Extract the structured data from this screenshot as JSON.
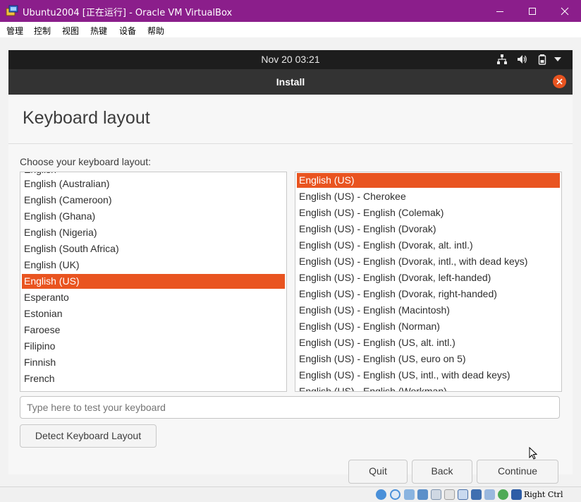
{
  "window": {
    "title": "Ubuntu2004 [正在运行] - Oracle VM VirtualBox",
    "icons": [
      "virtualbox-icon",
      "minimize-icon",
      "maximize-icon",
      "close-icon"
    ]
  },
  "menu": [
    "管理",
    "控制",
    "视图",
    "热键",
    "设备",
    "帮助"
  ],
  "topbar": {
    "clock": "Nov 20  03:21",
    "icons": [
      "network-icon",
      "volume-icon",
      "battery-icon",
      "chevron-down-icon"
    ]
  },
  "installer": {
    "header_title": "Install",
    "heading": "Keyboard layout",
    "prompt": "Choose your keyboard layout:",
    "layouts": [
      "English (Australian)",
      "English (Cameroon)",
      "English (Ghana)",
      "English (Nigeria)",
      "English (South Africa)",
      "English (UK)",
      "English (US)",
      "Esperanto",
      "Estonian",
      "Faroese",
      "Filipino",
      "Finnish",
      "French"
    ],
    "selected_layout": "English (US)",
    "variants": [
      "English (US)",
      "English (US) - Cherokee",
      "English (US) - English (Colemak)",
      "English (US) - English (Dvorak)",
      "English (US) - English (Dvorak, alt. intl.)",
      "English (US) - English (Dvorak, intl., with dead keys)",
      "English (US) - English (Dvorak, left-handed)",
      "English (US) - English (Dvorak, right-handed)",
      "English (US) - English (Macintosh)",
      "English (US) - English (Norman)",
      "English (US) - English (US, alt. intl.)",
      "English (US) - English (US, euro on 5)",
      "English (US) - English (US, intl., with dead keys)",
      "English (US) - English (Workman)"
    ],
    "selected_variant": "English (US)",
    "test_placeholder": "Type here to test your keyboard",
    "detect_button": "Detect Keyboard Layout",
    "quit_button": "Quit",
    "back_button": "Back",
    "continue_button": "Continue"
  },
  "statusbar": {
    "host_key": "Right Ctrl",
    "icons": [
      "hard-disk-icon",
      "optical-drive-icon",
      "audio-icon",
      "network-adapter-icon",
      "usb-icon",
      "shared-folder-icon",
      "display-icon",
      "video-capture-icon",
      "recording-icon",
      "cpu-virtualization-icon",
      "mouse-integration-icon",
      "keyboard-capture-icon"
    ]
  },
  "colors": {
    "titlebar": "#8b1e8b",
    "accent": "#e95420",
    "topbar": "#1d1d1d",
    "headerbar": "#333333"
  }
}
